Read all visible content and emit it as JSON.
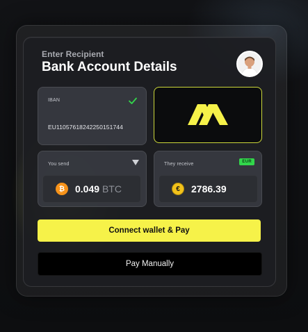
{
  "header": {
    "subtitle": "Enter Recipient",
    "title": "Bank Account Details"
  },
  "iban": {
    "label": "IBAN",
    "value": "EU11057618242250151744",
    "status": "verified",
    "check_color": "#32d74b"
  },
  "brand": {
    "logo_color": "#f6f249",
    "border_color": "#cdd93b"
  },
  "send": {
    "label": "You send",
    "amount": "0.049",
    "unit": "BTC",
    "coin_symbol": "₿"
  },
  "receive": {
    "label": "They receive",
    "badge": "EUR",
    "amount": "2786.39",
    "coin_symbol": "€"
  },
  "actions": {
    "connect_label": "Connect wallet & Pay",
    "manual_label": "Pay Manually"
  },
  "colors": {
    "accent": "#f6f249",
    "success": "#32d74b",
    "btc": "#f7931a",
    "eur": "#f2c21b"
  }
}
